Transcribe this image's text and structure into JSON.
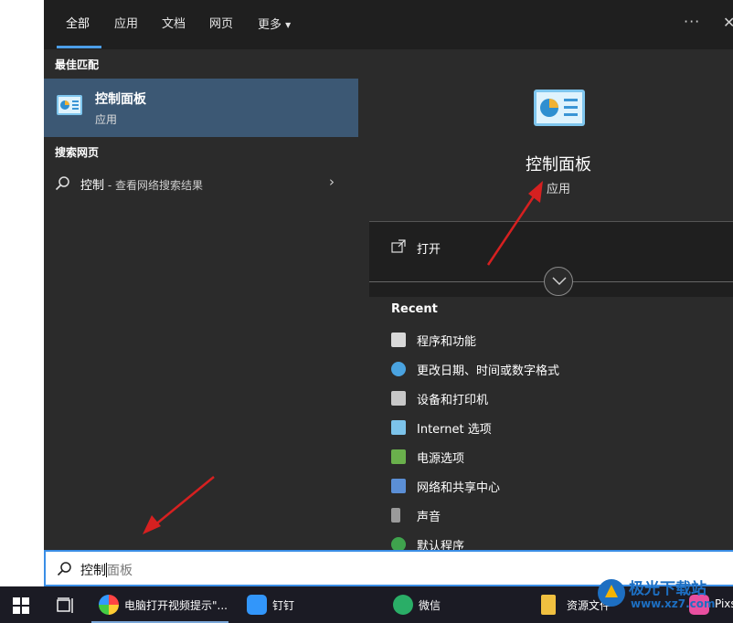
{
  "tabs": [
    "全部",
    "应用",
    "文档",
    "网页",
    "更多"
  ],
  "more_caret": "▾",
  "more_options": "···",
  "close": "✕",
  "best_match": {
    "header": "最佳匹配",
    "title": "控制面板",
    "subtitle": "应用"
  },
  "web": {
    "header": "搜索网页",
    "query": "控制",
    "suffix": " - 查看网络搜索结果"
  },
  "detail": {
    "title": "控制面板",
    "subtitle": "应用",
    "open": "打开"
  },
  "recent": {
    "header": "Recent",
    "items": [
      {
        "label": "程序和功能",
        "icon": "programs-features-icon"
      },
      {
        "label": "更改日期、时间或数字格式",
        "icon": "region-clock-icon"
      },
      {
        "label": "设备和打印机",
        "icon": "devices-printers-icon"
      },
      {
        "label": "Internet 选项",
        "icon": "internet-options-icon"
      },
      {
        "label": "电源选项",
        "icon": "power-options-icon"
      },
      {
        "label": "网络和共享中心",
        "icon": "network-sharing-icon"
      },
      {
        "label": "声音",
        "icon": "sound-icon"
      },
      {
        "label": "默认程序",
        "icon": "default-programs-icon"
      }
    ]
  },
  "search": {
    "typed": "控制",
    "hint": "面板"
  },
  "taskbar": {
    "apps": [
      {
        "label": "电脑打开视频提示\"...",
        "icon": "app-icon"
      },
      {
        "label": "钉钉",
        "icon": "dingtalk-icon"
      },
      {
        "label": "微信",
        "icon": "wechat-icon"
      },
      {
        "label": "资源文件",
        "icon": "folder-icon"
      },
      {
        "label": "Pixs",
        "icon": "pixs-icon"
      }
    ]
  },
  "watermark": {
    "text": "极光下载站",
    "url": "www.xz7.com"
  },
  "colors": {
    "accent": "#4c9ee8",
    "selection": "#3c5874",
    "arrow": "#d62020",
    "panel": "#2b2b2b"
  }
}
